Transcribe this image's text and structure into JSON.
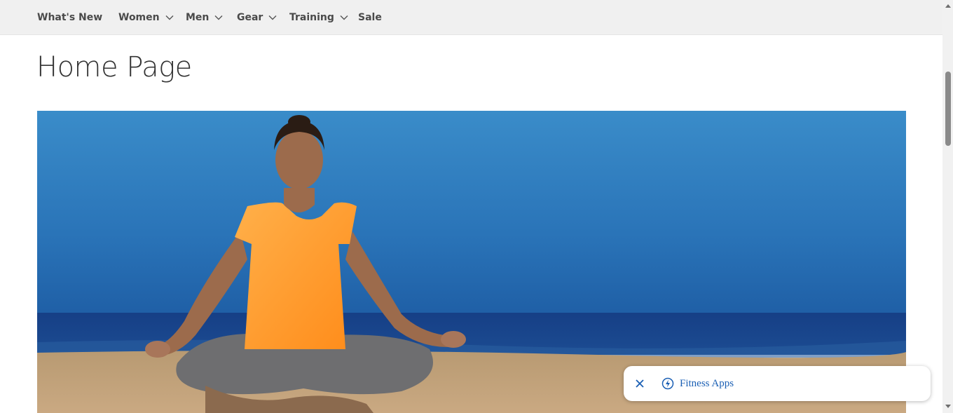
{
  "nav": {
    "items": [
      {
        "label": "What's New",
        "has_dropdown": false
      },
      {
        "label": "Women",
        "has_dropdown": true
      },
      {
        "label": "Men",
        "has_dropdown": true
      },
      {
        "label": "Gear",
        "has_dropdown": true
      },
      {
        "label": "Training",
        "has_dropdown": true
      },
      {
        "label": "Sale",
        "has_dropdown": false
      }
    ]
  },
  "page": {
    "title": "Home Page"
  },
  "hero": {
    "image_subject": "woman meditating in orange shirt on beach"
  },
  "floating_bar": {
    "close_icon": "close-icon",
    "link_icon": "lightning-bolt-icon",
    "link_label": "Fitness Apps"
  },
  "colors": {
    "nav_background": "#f0f0f0",
    "nav_text": "#4a4a4a",
    "title_text": "#333333",
    "link_blue": "#1a5fb4",
    "sky_blue": "#2f7fc1",
    "shirt_orange": "#ff9a2e"
  }
}
